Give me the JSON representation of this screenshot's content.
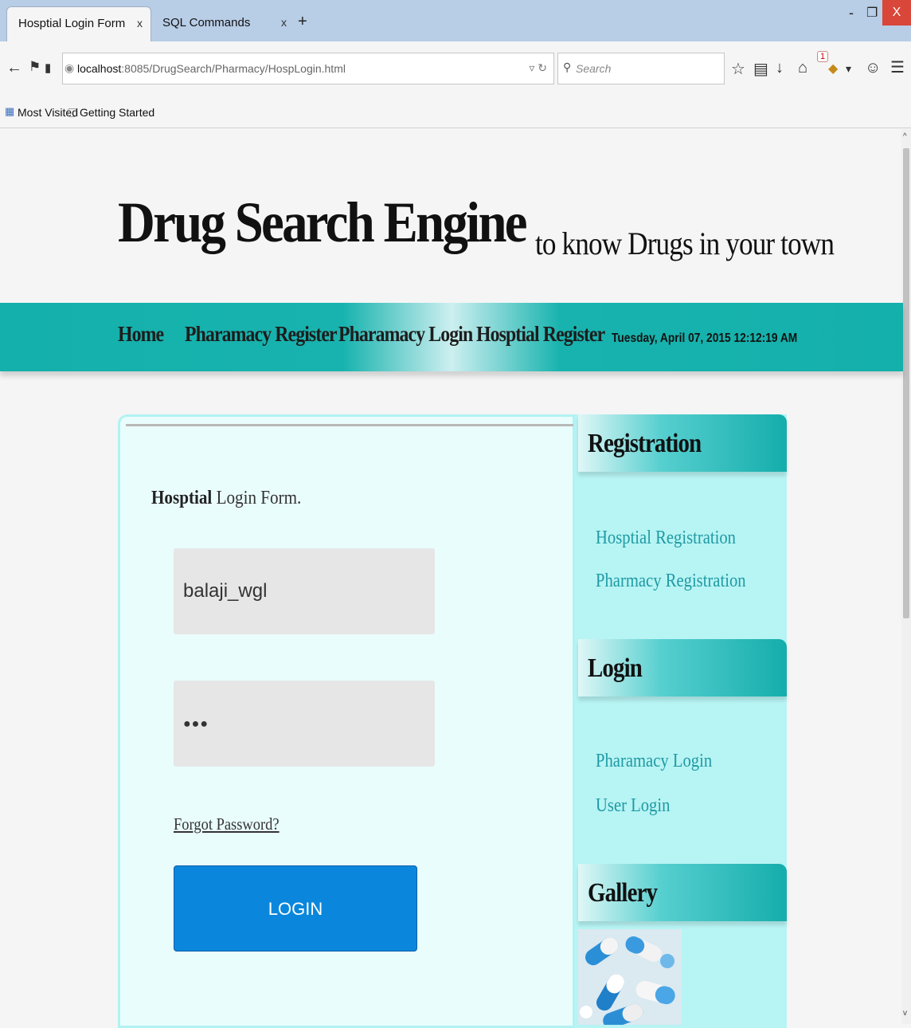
{
  "browser": {
    "tabs": [
      {
        "label": "Hosptial Login Form",
        "close": "x"
      },
      {
        "label": "SQL Commands",
        "close": "x"
      }
    ],
    "new_tab": "+",
    "window_controls": {
      "minimize": "-",
      "restore": "❐",
      "close": "X"
    },
    "url": {
      "host": "localhost",
      "rest": ":8085/DrugSearch/Pharmacy/HospLogin.html"
    },
    "search_placeholder": "Search",
    "badge_count": "1",
    "bookmarks": [
      "Most Visited",
      "Getting Started"
    ]
  },
  "site": {
    "title": "Drug Search Engine",
    "tagline": "to know Drugs in your town"
  },
  "nav": {
    "items": [
      "Home",
      "Pharamacy Register",
      "Pharamacy Login",
      "Hosptial Register"
    ],
    "date": "Tuesday, April 07, 2015 12:12:19 AM"
  },
  "form": {
    "heading_bold": "Hosptial",
    "heading_rest": " Login Form.",
    "username_value": "balaji_wgl",
    "password_value": "●●●",
    "forgot_label": "Forgot Password?",
    "login_label": "LOGIN"
  },
  "sidebar": {
    "registration": {
      "title": "Registration",
      "links": [
        "Hosptial Registration",
        "Pharmacy Registration"
      ]
    },
    "login": {
      "title": "Login",
      "links": [
        "Pharamacy Login",
        "User Login"
      ]
    },
    "gallery": {
      "title": "Gallery"
    }
  },
  "colors": {
    "nav_teal": "#14b0ab",
    "login_blue": "#0a87dc",
    "link_teal": "#1f9aa3",
    "panel_bg": "#eafdfd",
    "sidebar_bg": "#b7f4f4"
  }
}
